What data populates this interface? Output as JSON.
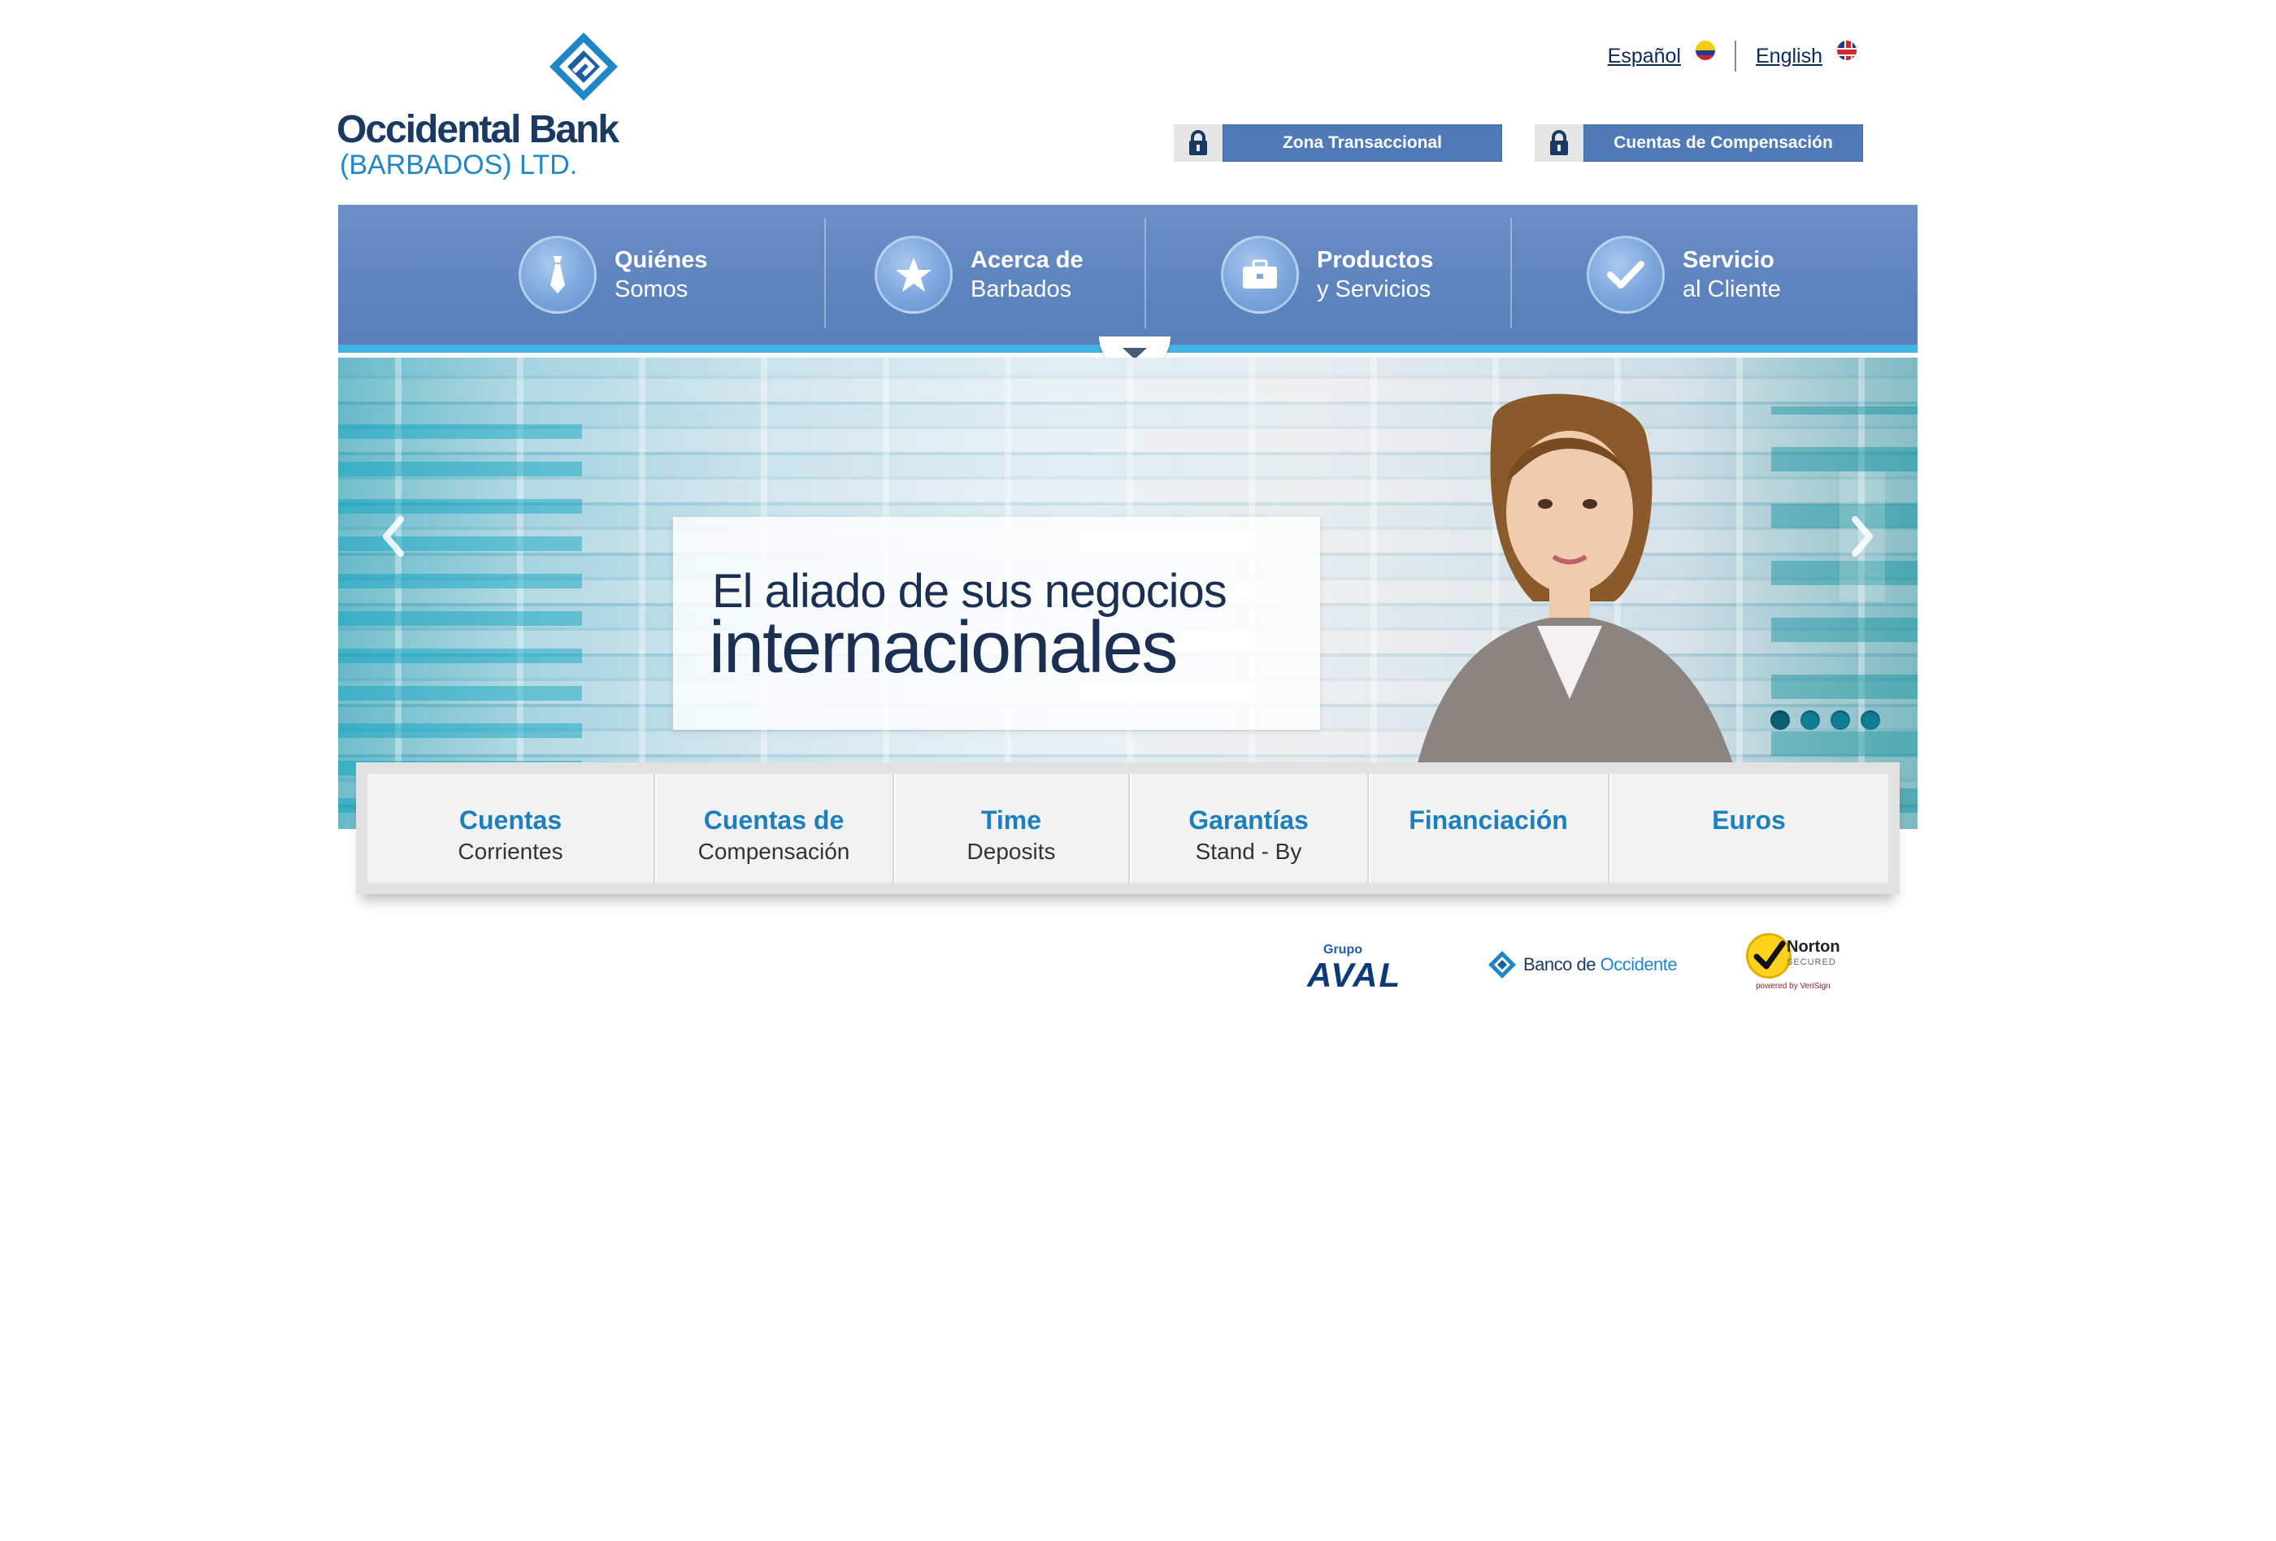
{
  "header": {
    "brand_name": "Occidental Bank",
    "brand_sub": "(BARBADOS) LTD.",
    "languages": [
      {
        "label": "Español",
        "flag": "colombia-flag-icon"
      },
      {
        "label": "English",
        "flag": "uk-flag-icon"
      }
    ],
    "access_buttons": [
      {
        "label": "Zona Transaccional",
        "icon": "lock-icon"
      },
      {
        "label": "Cuentas de Compensación",
        "icon": "lock-icon"
      }
    ]
  },
  "nav": {
    "items": [
      {
        "title": "Quiénes",
        "subtitle": "Somos",
        "icon": "tie-icon"
      },
      {
        "title": "Acerca de",
        "subtitle": "Barbados",
        "icon": "star-icon"
      },
      {
        "title": "Productos",
        "subtitle": "y Servicios",
        "icon": "briefcase-icon"
      },
      {
        "title": "Servicio",
        "subtitle": "al Cliente",
        "icon": "check-icon"
      }
    ]
  },
  "hero": {
    "headline_line1": "El aliado de sus negocios",
    "headline_line2": "internacionales",
    "slide_count": 4,
    "active_slide": 1
  },
  "products": [
    {
      "title": "Cuentas",
      "subtitle": "Corrientes"
    },
    {
      "title": "Cuentas de",
      "subtitle": "Compensación"
    },
    {
      "title": "Time",
      "subtitle": "Deposits"
    },
    {
      "title": "Garantías",
      "subtitle": "Stand - By"
    },
    {
      "title": "Financiación",
      "subtitle": ""
    },
    {
      "title": "Euros",
      "subtitle": ""
    }
  ],
  "partners": {
    "aval_top": "Grupo",
    "aval_main": "AVAL",
    "bdo_prefix": "Banco de ",
    "bdo_name": "Occidente",
    "norton_title": "Norton",
    "norton_sub": "SECURED",
    "norton_powered": "powered by VeriSign"
  },
  "colors": {
    "brand_navy": "#1b3a63",
    "brand_blue": "#1f86c8",
    "nav_blue": "#5e84bf",
    "button_blue": "#4f7ab8",
    "accent_cyan": "#42b3e5"
  }
}
